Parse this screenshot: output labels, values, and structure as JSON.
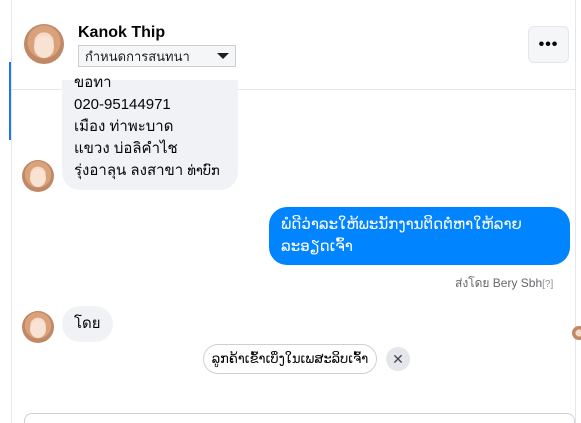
{
  "header": {
    "contact_name": "Kanok Thip",
    "status_label": "กำหนดการสนทนา",
    "more_icon": "more-horizontal-icon",
    "more_glyph": "•••"
  },
  "messages": [
    {
      "direction": "incoming",
      "lines": [
        "ขอทา",
        "020-95144971",
        "เมือง ท่าพะบาด",
        "แขวง บ่อลิคำไช",
        "รุ่งอาลุน ลงสาขา"
      ],
      "trailing": "ທ່າບົກ"
    },
    {
      "direction": "outgoing",
      "text": "ພໍດີວ່າລະໃຫ້ພະນັກງານຕິດຕໍ່ຫາໃຫ້ລາຍລະອຽດເຈົ້າ",
      "sent_by": "ส่งโดย Bery Sbh",
      "sent_by_help": "[?]"
    },
    {
      "direction": "incoming",
      "text": "โดย"
    }
  ],
  "suggestion": {
    "label": "ລູກຄ້າເຂົ້າເບິ່ງໃນເພສະລິບເຈົ້າ",
    "dismiss_icon": "close-icon",
    "dismiss_glyph": "✕"
  },
  "colors": {
    "accent": "#1877f2",
    "outgoing_bubble": "#0084ff",
    "incoming_bubble": "#f0f2f5"
  }
}
